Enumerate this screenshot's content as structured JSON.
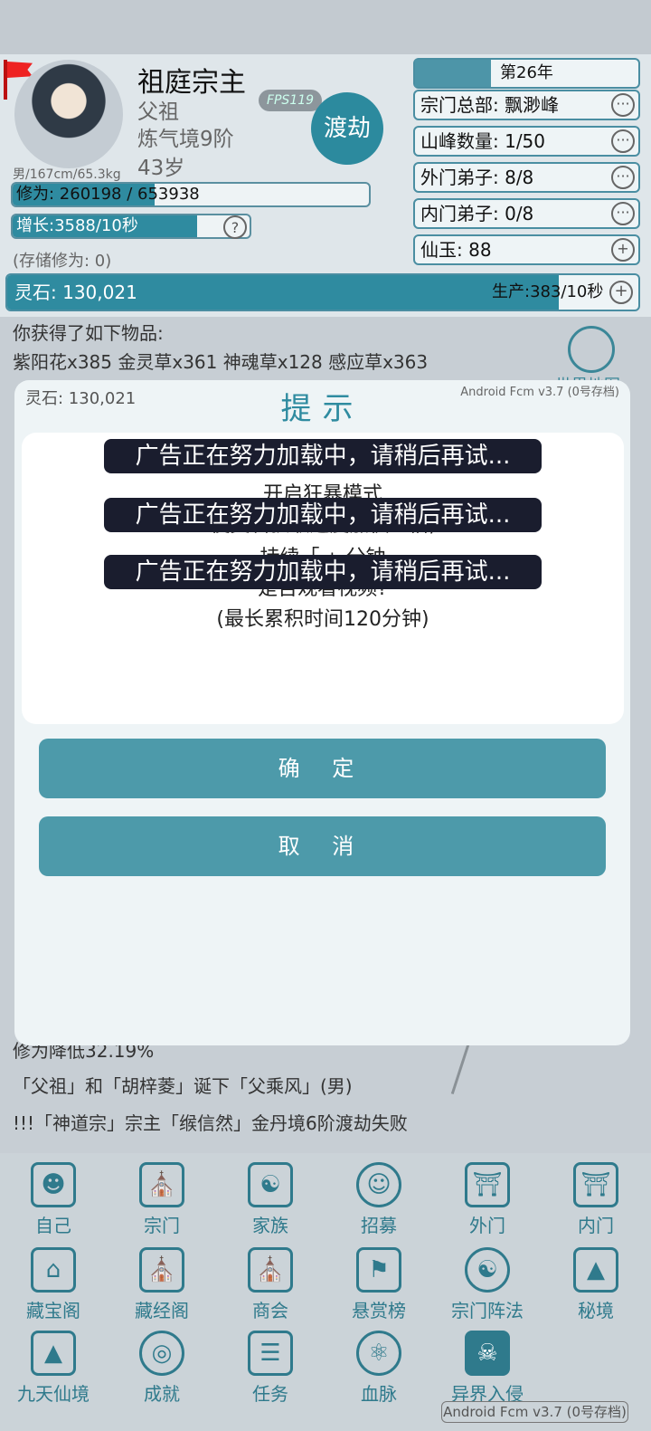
{
  "header": {
    "name": "祖庭宗主",
    "title": "父祖",
    "realm": "炼气境9阶",
    "age": "43岁",
    "fps": "FPS119",
    "dujie": "渡劫",
    "gender_info": "男/167cm/65.3kg",
    "cultivation": "修为: 260198 / 653938",
    "cultivation_progress": 0.398,
    "growth": "增长:3588/10秒",
    "growth_help": "?",
    "stored": "(存储修为: 0)"
  },
  "right_panel": {
    "year": "第26年",
    "year_progress": 0.33,
    "hq": "宗门总部: 飘渺峰",
    "peaks": "山峰数量: 1/50",
    "outer": "外门弟子: 8/8",
    "inner": "内门弟子: 0/8",
    "jade": "仙玉: 88",
    "more": "···",
    "plus": "+"
  },
  "lingshi": {
    "label": "灵石: 130,021",
    "production": "生产:383/10秒",
    "plus": "+"
  },
  "log": {
    "line1": "你获得了如下物品:",
    "line2": "紫阳花x385 金灵草x361 神魂草x128 感应草x363",
    "line3": "修为降低32.19%",
    "line4": "「父祖」和「胡梓菱」诞下「父乘风」(男)",
    "line5": "!!!「神道宗」宗主「缑信然」金丹境6阶渡劫失败"
  },
  "world_map": "世界地图",
  "dialog": {
    "lingshi": "灵石: 130,021",
    "title": "提示",
    "version": "Android Fcm v3.7 (0号存档)",
    "line1": "开启狂暴模式",
    "line2": "使灵石获取速度加快一倍,",
    "line3": "持续「     」分钟",
    "line4": "是否观看视频?",
    "line5": "(最长累积时间120分钟)",
    "toast": "广告正在努力加载中，请稍后再试...",
    "confirm": "确 定",
    "cancel": "取 消"
  },
  "nav": {
    "row1": [
      "自己",
      "宗门",
      "家族",
      "招募",
      "外门",
      "内门"
    ],
    "row2": [
      "藏宝阁",
      "藏经阁",
      "商会",
      "悬赏榜",
      "宗门阵法",
      "秘境"
    ],
    "row3": [
      "九天仙境",
      "成就",
      "任务",
      "血脉",
      "异界入侵"
    ]
  },
  "version_bottom": "Android Fcm v3.7 (0号存档)",
  "colors": {
    "accent": "#2f8ba0",
    "toast_bg": "#1a1d2e",
    "button": "#4d9aaa"
  }
}
